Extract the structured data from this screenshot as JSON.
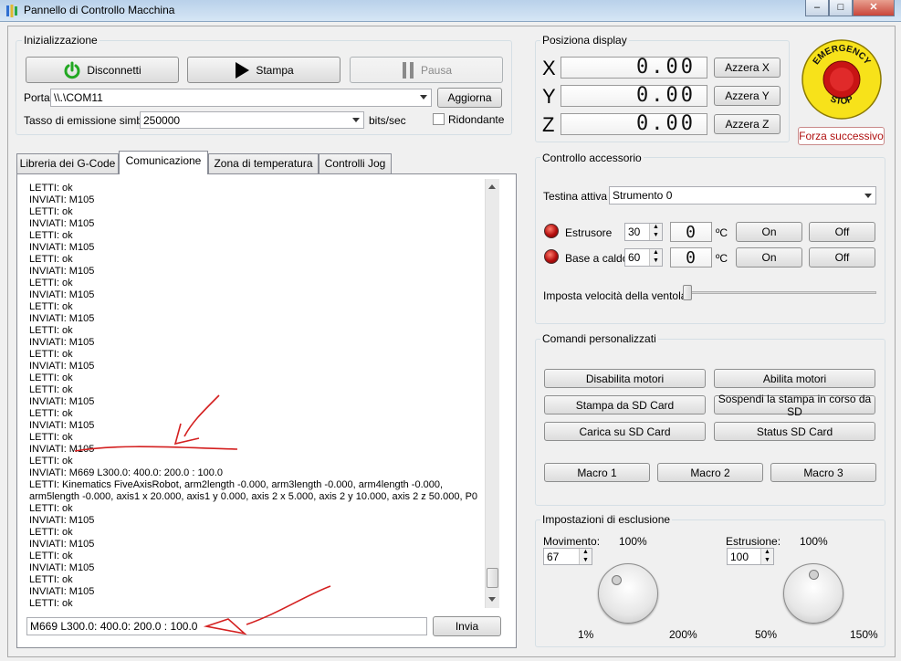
{
  "window": {
    "title": "Pannello di Controllo Macchina",
    "minimize": "–",
    "maximize": "□",
    "close": "✕"
  },
  "init": {
    "group_label": "Inizializzazione",
    "connect_label": "Disconnetti",
    "print_label": "Stampa",
    "pause_label": "Pausa",
    "port_label": "Porta",
    "port_value": "\\\\.\\COM11",
    "refresh_label": "Aggiorna",
    "baud_label": "Tasso di emissione simboli",
    "baud_value": "250000",
    "baud_unit": "bits/sec",
    "redundant_label": "Ridondante"
  },
  "tabs": [
    "Libreria dei G-Code",
    "Comunicazione",
    "Zona di temperatura",
    "Controlli Jog"
  ],
  "log": {
    "lines": [
      "LETTI: ok",
      "INVIATI: M105",
      "LETTI: ok",
      "INVIATI: M105",
      "LETTI: ok",
      "INVIATI: M105",
      "LETTI: ok",
      "INVIATI: M105",
      "LETTI: ok",
      "INVIATI: M105",
      "LETTI: ok",
      "INVIATI: M105",
      "LETTI: ok",
      "INVIATI: M105",
      "LETTI: ok",
      "INVIATI: M105",
      "LETTI: ok",
      "LETTI: ok",
      "INVIATI: M105",
      "LETTI: ok",
      "INVIATI: M105",
      "LETTI: ok",
      "INVIATI: M105",
      "LETTI: ok",
      "INVIATI:  M669 L300.0: 400.0: 200.0 : 100.0",
      "LETTI: Kinematics FiveAxisRobot, arm2length -0.000, arm3length -0.000, arm4length -0.000,",
      "arm5length -0.000, axis1 x 20.000, axis1 y 0.000, axis 2 x 5.000, axis 2 y 10.000, axis 2 z 50.000, P0",
      "LETTI: ok",
      "INVIATI: M105",
      "LETTI: ok",
      "INVIATI: M105",
      "LETTI: ok",
      "INVIATI: M105",
      "LETTI: ok",
      "INVIATI: M105",
      "LETTI: ok"
    ],
    "command_value": "M669 L300.0: 400.0: 200.0 : 100.0",
    "send_label": "Invia"
  },
  "position": {
    "group_label": "Posiziona display",
    "axes": [
      {
        "name": "X",
        "value": "0.00",
        "reset_label": "Azzera X"
      },
      {
        "name": "Y",
        "value": "0.00",
        "reset_label": "Azzera Y"
      },
      {
        "name": "Z",
        "value": "0.00",
        "reset_label": "Azzera Z"
      }
    ]
  },
  "emergency": {
    "top_text": "EMERGENCY",
    "bottom_text": "STOP",
    "force_label": "Forza successivo"
  },
  "accessory": {
    "group_label": "Controllo accessorio",
    "head_label": "Testina attiva",
    "head_value": "Strumento 0",
    "extruder_label": "Estrusore",
    "extruder_set": "30",
    "extruder_temp": "0",
    "bed_label": "Base a caldo",
    "bed_set": "60",
    "bed_temp": "0",
    "unit": "ºC",
    "on_label": "On",
    "off_label": "Off",
    "fan_label": "Imposta velocità della ventola",
    "fan_level": 0
  },
  "custom": {
    "group_label": "Comandi personalizzati",
    "buttons": [
      "Disabilita motori",
      "Abilita motori",
      "Stampa da SD Card",
      "Sospendi la stampa in corso da SD",
      "Carica su SD Card",
      "Status SD Card"
    ],
    "macros": [
      "Macro 1",
      "Macro 2",
      "Macro 3"
    ]
  },
  "override": {
    "group_label": "Impostazioni di esclusione",
    "movement_label": "Movimento:",
    "movement_value": "67",
    "movement_mid": "100%",
    "movement_min": "1%",
    "movement_max": "200%",
    "extrusion_label": "Estrusione:",
    "extrusion_value": "100",
    "extrusion_mid": "100%",
    "extrusion_min": "50%",
    "extrusion_max": "150%"
  },
  "colors": {
    "accent_red": "#d42020",
    "led_red": "#b40e0e",
    "button_green": "#22a822"
  }
}
